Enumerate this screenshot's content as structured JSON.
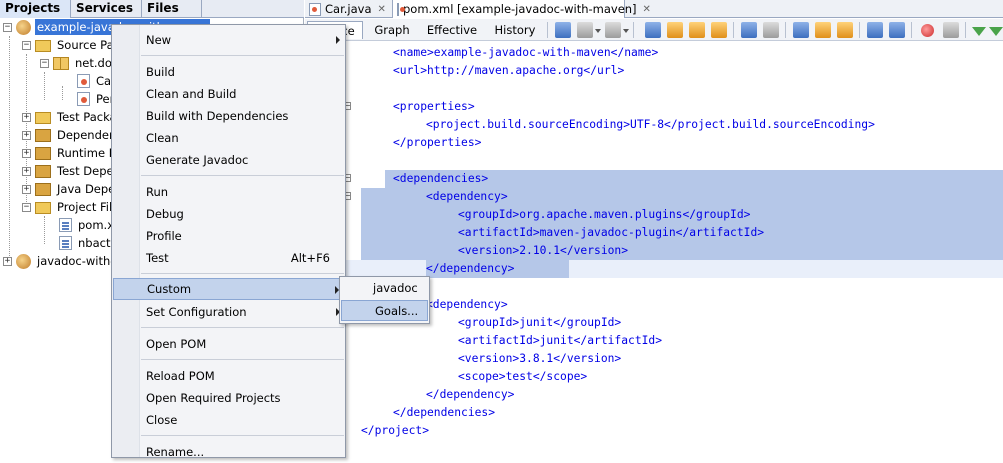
{
  "left_tabs": [
    "Projects",
    "Services",
    "Files"
  ],
  "tree": [
    {
      "label": "example-javadoc-with-maven",
      "icon": "maven-project-icon",
      "selected": true
    },
    {
      "label": "Source Packages",
      "icon": "folder-icon"
    },
    {
      "label": "net.dojo",
      "icon": "package-icon"
    },
    {
      "label": "Car.java",
      "icon": "java-file-icon"
    },
    {
      "label": "Person.java",
      "icon": "java-file-icon"
    },
    {
      "label": "Test Packages",
      "icon": "folder-icon"
    },
    {
      "label": "Dependencies",
      "icon": "library-folder-icon"
    },
    {
      "label": "Runtime Dependencies",
      "icon": "library-folder-icon"
    },
    {
      "label": "Test Dependencies",
      "icon": "library-folder-icon"
    },
    {
      "label": "Java Dependencies",
      "icon": "library-folder-icon"
    },
    {
      "label": "Project Files",
      "icon": "folder-icon"
    },
    {
      "label": "pom.xml",
      "icon": "xml-file-icon"
    },
    {
      "label": "nbactions.xml",
      "icon": "xml-file-icon"
    },
    {
      "label": "javadoc-with-maven",
      "icon": "maven-project-icon"
    }
  ],
  "editor_tabs": [
    {
      "label": "Car.java"
    },
    {
      "label": "pom.xml [example-javadoc-with-maven]"
    }
  ],
  "view_tabs": [
    "Source",
    "Graph",
    "Effective",
    "History"
  ],
  "code_lines": [
    "<name>example-javadoc-with-maven</name>",
    "<url>http://maven.apache.org</url>",
    "",
    "<properties>",
    "<project.build.sourceEncoding>UTF-8</project.build.sourceEncoding>",
    "</properties>",
    "",
    "<dependencies>",
    "<dependency>",
    "<groupId>org.apache.maven.plugins</groupId>",
    "<artifactId>maven-javadoc-plugin</artifactId>",
    "<version>2.10.1</version>",
    "</dependency>",
    "",
    "<dependency>",
    "<groupId>junit</groupId>",
    "<artifactId>junit</artifactId>",
    "<version>3.8.1</version>",
    "<scope>test</scope>",
    "</dependency>",
    "</dependencies>",
    "</project>"
  ],
  "context_menu": {
    "new": "New",
    "build": "Build",
    "clean_and_build": "Clean and Build",
    "build_with_dependencies": "Build with Dependencies",
    "clean": "Clean",
    "generate_javadoc": "Generate Javadoc",
    "run": "Run",
    "debug": "Debug",
    "profile": "Profile",
    "test": "Test",
    "test_shortcut": "Alt+F6",
    "custom": "Custom",
    "set_configuration": "Set Configuration",
    "open_pom": "Open POM",
    "reload_pom": "Reload POM",
    "open_required_projects": "Open Required Projects",
    "close": "Close",
    "rename": "Rename..."
  },
  "submenu": {
    "javadoc": "javadoc",
    "goals": "Goals..."
  },
  "colors": {
    "selection": "#3875d7",
    "menu_highlight": "#c3d3ec",
    "code_selection": "#b5c7e8",
    "xml_tag": "#0000e6"
  }
}
